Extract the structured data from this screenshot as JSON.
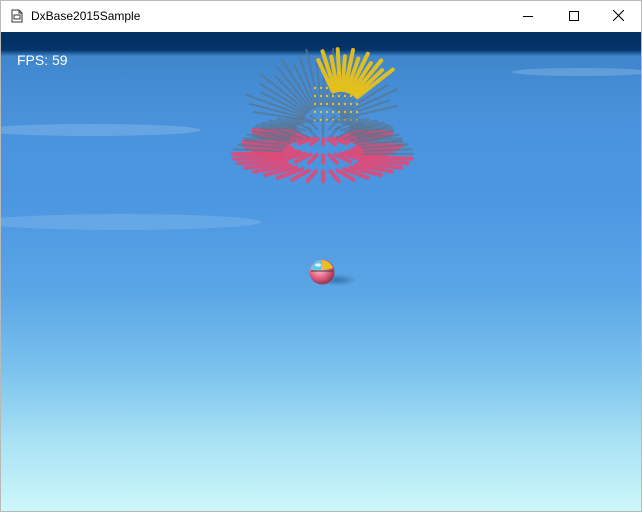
{
  "window": {
    "title": "DxBase2015Sample",
    "icon": "app-document-icon",
    "controls": {
      "minimize": "minimize-icon",
      "maximize": "maximize-icon",
      "close": "close-icon"
    }
  },
  "viewport": {
    "fps_text": "FPS: 59",
    "colors": {
      "top_band": "#043061",
      "sky_mid": "#4c97e2",
      "sky_bottom": "#cdf7fa",
      "spike_pink": "#e04a78",
      "spike_yellow": "#e8c21a",
      "spike_gray": "#5a7590"
    }
  }
}
